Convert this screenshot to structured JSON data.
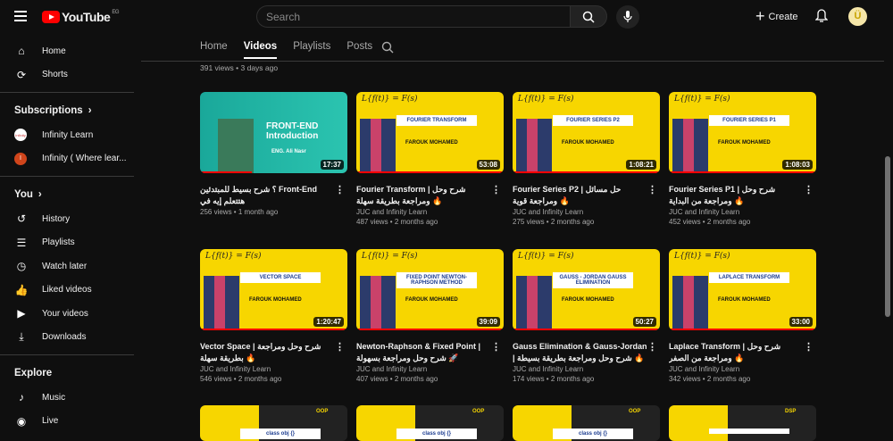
{
  "header": {
    "logo": "YouTube",
    "country": "EG",
    "search_placeholder": "Search",
    "create": "Create",
    "avatar": "Ü"
  },
  "sidebar": {
    "main": [
      {
        "label": "Home",
        "icon": "home-icon",
        "g": "⌂"
      },
      {
        "label": "Shorts",
        "icon": "shorts-icon",
        "g": "⟳"
      }
    ],
    "subscriptions_title": "Subscriptions",
    "subscriptions": [
      {
        "label": "Infinity Learn",
        "avatar": "Infinity",
        "color": "#ffffff"
      },
      {
        "label": "Infinity ( Where lear...",
        "avatar": "I",
        "color": "#d0451b"
      }
    ],
    "you_title": "You",
    "you": [
      {
        "label": "History",
        "icon": "history-icon",
        "g": "↺"
      },
      {
        "label": "Playlists",
        "icon": "playlists-icon",
        "g": "☰"
      },
      {
        "label": "Watch later",
        "icon": "clock-icon",
        "g": "◷"
      },
      {
        "label": "Liked videos",
        "icon": "thumbs-up-icon",
        "g": "👍"
      },
      {
        "label": "Your videos",
        "icon": "your-videos-icon",
        "g": "▶"
      },
      {
        "label": "Downloads",
        "icon": "download-icon",
        "g": "⤓"
      }
    ],
    "explore_title": "Explore",
    "explore": [
      {
        "label": "Music",
        "icon": "music-icon",
        "g": "♪"
      },
      {
        "label": "Live",
        "icon": "live-icon",
        "g": "◉"
      }
    ]
  },
  "tabs": [
    {
      "label": "Home"
    },
    {
      "label": "Videos",
      "active": true
    },
    {
      "label": "Playlists"
    },
    {
      "label": "Posts"
    }
  ],
  "previous_meta": "391 views • 3 days ago",
  "videos": [
    {
      "title": "؟ شرح بسيط للمبتدئين Front-End هتتعلم إيه في",
      "channel": "",
      "meta": "256 views • 1 month ago",
      "duration": "17:37",
      "thumb": "FRONT-END Introduction",
      "thumb_sub": "ENG. Ali Nasr",
      "style": "fe",
      "progress": 0.35
    },
    {
      "title": "Fourier Transform | شرح وحل ومراجعة بطريقة سهلة 🔥",
      "channel": "JUC and Infinity Learn",
      "meta": "487 views • 2 months ago",
      "duration": "53:08",
      "thumb": "FOURIER TRANSFORM",
      "thumb_sub": "FAROUK MOHAMED",
      "style": "math",
      "progress": 1
    },
    {
      "title": "Fourier Series P2 | حل مسائل ومراجعة قوية 🔥",
      "channel": "JUC and Infinity Learn",
      "meta": "275 views • 2 months ago",
      "duration": "1:08:21",
      "thumb": "FOURIER SERIES P2",
      "thumb_sub": "FAROUK MOHAMED",
      "style": "math",
      "progress": 1
    },
    {
      "title": "Fourier Series P1 | شرح وحل ومراجعة من البداية 🔥",
      "channel": "JUC and Infinity Learn",
      "meta": "452 views • 2 months ago",
      "duration": "1:08:03",
      "thumb": "FOURIER SERIES P1",
      "thumb_sub": "FAROUK MOHAMED",
      "style": "math",
      "progress": 1
    },
    {
      "title": "Vector Space | شرح وحل ومراجعة بطريقة سهلة 🔥",
      "channel": "JUC and Infinity Learn",
      "meta": "546 views • 2 months ago",
      "duration": "1:20:47",
      "thumb": "VECTOR SPACE",
      "thumb_sub": "FAROUK MOHAMED",
      "style": "math",
      "progress": 1
    },
    {
      "title": "Newton-Raphson & Fixed Point | شرح وحل ومراجعة بسهولة 🚀",
      "channel": "JUC and Infinity Learn",
      "meta": "407 views • 2 months ago",
      "duration": "39:09",
      "thumb": "FIXED POINT NEWTON-RAPHSON METHOD",
      "thumb_sub": "FAROUK MOHAMED",
      "style": "math",
      "progress": 1
    },
    {
      "title": "Gauss Elimination & Gauss-Jordan | شرح وحل ومراجعة بطريقة بسيطة 🔥",
      "channel": "JUC and Infinity Learn",
      "meta": "174 views • 2 months ago",
      "duration": "50:27",
      "thumb": "GAUSS - JORDAN GAUSS ELIMINATION",
      "thumb_sub": "FAROUK MOHAMED",
      "style": "math",
      "progress": 1
    },
    {
      "title": "Laplace Transform | شرح وحل ومراجعة من الصفر 🔥",
      "channel": "JUC and Infinity Learn",
      "meta": "342 views • 2 months ago",
      "duration": "33:00",
      "thumb": "LAPLACE TRANSFORM",
      "thumb_sub": "FAROUK MOHAMED",
      "style": "math",
      "progress": 1
    },
    {
      "title": "",
      "channel": "",
      "meta": "",
      "duration": "",
      "thumb": "class obj {}",
      "thumb_sub": "OOP",
      "style": "code",
      "progress": 0
    },
    {
      "title": "",
      "channel": "",
      "meta": "",
      "duration": "",
      "thumb": "class obj {}",
      "thumb_sub": "OOP",
      "style": "code",
      "progress": 0
    },
    {
      "title": "",
      "channel": "",
      "meta": "",
      "duration": "",
      "thumb": "class obj {}",
      "thumb_sub": "OOP",
      "style": "code",
      "progress": 0
    },
    {
      "title": "",
      "channel": "",
      "meta": "",
      "duration": "",
      "thumb": "",
      "thumb_sub": "DSP",
      "style": "code",
      "progress": 0
    }
  ]
}
